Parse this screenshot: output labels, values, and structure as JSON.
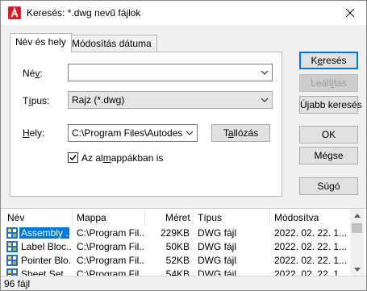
{
  "window": {
    "title": "Keresés: *.dwg nevű fájlok",
    "close_glyph": "✕"
  },
  "tabs": [
    {
      "label": "Név és hely",
      "active": true
    },
    {
      "label": "Módosítás dátuma",
      "active": false
    }
  ],
  "form": {
    "name_label_pre": "Né",
    "name_label_u": "v",
    "name_label_post": ":",
    "name_value": "",
    "type_label_pre": "T",
    "type_label_u": "í",
    "type_label_post": "pus:",
    "type_value": "Rajz (*.dwg)",
    "location_label_pre": "",
    "location_label_u": "H",
    "location_label_post": "ely:",
    "location_value": "C:\\Program Files\\Autodesk\\A",
    "browse_button_pre": "T",
    "browse_button_u": "a",
    "browse_button_post": "llózás",
    "subfolders_label_pre": "Az al",
    "subfolders_label_u": "m",
    "subfolders_label_post": "appákban is",
    "subfolders_checked": true
  },
  "buttons": {
    "search_pre": "K",
    "search_u": "e",
    "search_post": "resés",
    "stop_pre": "Leáll",
    "stop_u": "í",
    "stop_post": "tás",
    "new_search_pre": "Ú",
    "new_search_u": "j",
    "new_search_post": "abb keresés",
    "ok": "OK",
    "cancel": "Mégse",
    "help": "Súgó"
  },
  "results": {
    "columns": [
      "Név",
      "Mappa",
      "Méret",
      "Típus",
      "Módosítva"
    ],
    "rows": [
      {
        "name": "Assembly ...",
        "folder": "C:\\Program Fil...",
        "size": "229KB",
        "type": "DWG fájl",
        "modified": "2022. 02. 22. 1..."
      },
      {
        "name": "Label Bloc...",
        "folder": "C:\\Program Fil...",
        "size": "50KB",
        "type": "DWG fájl",
        "modified": "2022. 02. 22. 1..."
      },
      {
        "name": "Pointer Blo...",
        "folder": "C:\\Program Fil...",
        "size": "52KB",
        "type": "DWG fájl",
        "modified": "2022. 02. 22. 1..."
      },
      {
        "name": "Sheet Set...",
        "folder": "C:\\Program Fil...",
        "size": "54KB",
        "type": "DWG fájl",
        "modified": "2022. 02. 22. 1..."
      }
    ]
  },
  "status": {
    "count_text": "96 fájl"
  },
  "colors": {
    "accent": "#0078d7",
    "autocad_red": "#d81e2a",
    "selection": "#0078d7"
  }
}
